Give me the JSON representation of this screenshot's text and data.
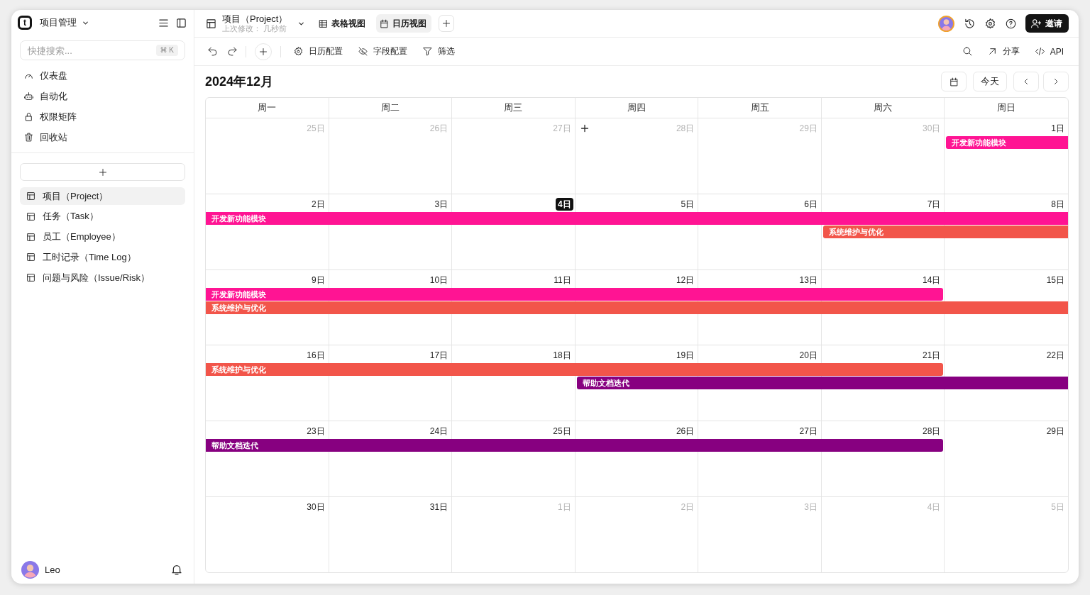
{
  "sidebar": {
    "logo": "t",
    "workspace": "项目管理",
    "search": {
      "placeholder": "快捷搜索...",
      "shortcut": "⌘ K"
    },
    "nav": [
      {
        "label": "仪表盘",
        "kind": "dashboard"
      },
      {
        "label": "自动化",
        "kind": "automation"
      },
      {
        "label": "权限矩阵",
        "kind": "permissions"
      },
      {
        "label": "回收站",
        "kind": "trash"
      }
    ],
    "tables": [
      {
        "label": "项目（Project）",
        "selected": true
      },
      {
        "label": "任务（Task）",
        "selected": false
      },
      {
        "label": "员工（Employee）",
        "selected": false
      },
      {
        "label": "工时记录（Time Log）",
        "selected": false
      },
      {
        "label": "问题与风险（Issue/Risk）",
        "selected": false
      }
    ],
    "user": {
      "name": "Leo"
    }
  },
  "header": {
    "title": "项目（Project）",
    "subtitle": "上次修改： 几秒前",
    "views": [
      {
        "label": "表格视图",
        "kind": "grid",
        "selected": false
      },
      {
        "label": "日历视图",
        "kind": "calendar",
        "selected": true
      }
    ],
    "invite": "邀请"
  },
  "toolbar": {
    "left": [
      {
        "label": "日历配置",
        "kind": "settings"
      },
      {
        "label": "字段配置",
        "kind": "hidden"
      },
      {
        "label": "筛选",
        "kind": "filter"
      }
    ],
    "right": [
      {
        "label": "分享",
        "kind": "share"
      },
      {
        "label": "API",
        "kind": "api"
      }
    ]
  },
  "calendar": {
    "title": "2024年12月",
    "today_button": "今天",
    "weekdays": [
      "周一",
      "周二",
      "周三",
      "周四",
      "周五",
      "周六",
      "周日"
    ],
    "weeks": [
      {
        "days": [
          {
            "label": "25日",
            "kind": "plain",
            "in_month": false,
            "today": false
          },
          {
            "label": "26日",
            "kind": "plain",
            "in_month": false,
            "today": false
          },
          {
            "label": "27日",
            "kind": "plain",
            "in_month": false,
            "today": false
          },
          {
            "label": "28日",
            "kind": "hover",
            "in_month": false,
            "today": false
          },
          {
            "label": "29日",
            "kind": "plain",
            "in_month": false,
            "today": false
          },
          {
            "label": "30日",
            "kind": "plain",
            "in_month": false,
            "today": false
          },
          {
            "label": "1日",
            "kind": "plain",
            "in_month": true,
            "today": false
          }
        ],
        "lanes": [
          [
            {
              "kind": "free"
            },
            {
              "kind": "free"
            },
            {
              "kind": "free"
            },
            {
              "kind": "free"
            },
            {
              "kind": "free"
            },
            {
              "kind": "free"
            },
            {
              "kind": "event",
              "title": "开发新功能模块",
              "color": "#ff1493",
              "starts": true,
              "ends": false
            }
          ]
        ]
      },
      {
        "days": [
          {
            "label": "2日",
            "kind": "plain",
            "in_month": true,
            "today": false
          },
          {
            "label": "3日",
            "kind": "plain",
            "in_month": true,
            "today": false
          },
          {
            "label": "4日",
            "kind": "plain",
            "in_month": true,
            "today": true
          },
          {
            "label": "5日",
            "kind": "plain",
            "in_month": true,
            "today": false
          },
          {
            "label": "6日",
            "kind": "plain",
            "in_month": true,
            "today": false
          },
          {
            "label": "7日",
            "kind": "plain",
            "in_month": true,
            "today": false
          },
          {
            "label": "8日",
            "kind": "plain",
            "in_month": true,
            "today": false
          }
        ],
        "lanes": [
          [
            {
              "kind": "event",
              "title": "开发新功能模块",
              "color": "#ff1493",
              "starts": false,
              "ends": false
            },
            {
              "kind": "more"
            },
            {
              "kind": "more"
            },
            {
              "kind": "more"
            },
            {
              "kind": "more"
            },
            {
              "kind": "more"
            },
            {
              "kind": "more"
            }
          ],
          [
            {
              "kind": "free"
            },
            {
              "kind": "free"
            },
            {
              "kind": "free"
            },
            {
              "kind": "free"
            },
            {
              "kind": "free"
            },
            {
              "kind": "event",
              "title": "系统维护与优化",
              "color": "#f2554a",
              "starts": true,
              "ends": false
            },
            {
              "kind": "more"
            }
          ]
        ]
      },
      {
        "days": [
          {
            "label": "9日",
            "kind": "plain",
            "in_month": true,
            "today": false
          },
          {
            "label": "10日",
            "kind": "plain",
            "in_month": true,
            "today": false
          },
          {
            "label": "11日",
            "kind": "plain",
            "in_month": true,
            "today": false
          },
          {
            "label": "12日",
            "kind": "plain",
            "in_month": true,
            "today": false
          },
          {
            "label": "13日",
            "kind": "plain",
            "in_month": true,
            "today": false
          },
          {
            "label": "14日",
            "kind": "plain",
            "in_month": true,
            "today": false
          },
          {
            "label": "15日",
            "kind": "plain",
            "in_month": true,
            "today": false
          }
        ],
        "lanes": [
          [
            {
              "kind": "event",
              "title": "开发新功能模块",
              "color": "#ff1493",
              "starts": false,
              "ends": true
            },
            {
              "kind": "more"
            },
            {
              "kind": "more"
            },
            {
              "kind": "more"
            },
            {
              "kind": "more"
            },
            {
              "kind": "more"
            }
          ],
          [
            {
              "kind": "event",
              "title": "系统维护与优化",
              "color": "#f2554a",
              "starts": false,
              "ends": false
            },
            {
              "kind": "more"
            },
            {
              "kind": "more"
            },
            {
              "kind": "more"
            },
            {
              "kind": "more"
            },
            {
              "kind": "more"
            },
            {
              "kind": "more"
            }
          ]
        ]
      },
      {
        "days": [
          {
            "label": "16日",
            "kind": "plain",
            "in_month": true,
            "today": false
          },
          {
            "label": "17日",
            "kind": "plain",
            "in_month": true,
            "today": false
          },
          {
            "label": "18日",
            "kind": "plain",
            "in_month": true,
            "today": false
          },
          {
            "label": "19日",
            "kind": "plain",
            "in_month": true,
            "today": false
          },
          {
            "label": "20日",
            "kind": "plain",
            "in_month": true,
            "today": false
          },
          {
            "label": "21日",
            "kind": "plain",
            "in_month": true,
            "today": false
          },
          {
            "label": "22日",
            "kind": "plain",
            "in_month": true,
            "today": false
          }
        ],
        "lanes": [
          [
            {
              "kind": "event",
              "title": "系统维护与优化",
              "color": "#f2554a",
              "starts": false,
              "ends": true
            },
            {
              "kind": "more"
            },
            {
              "kind": "more"
            },
            {
              "kind": "more"
            },
            {
              "kind": "more"
            },
            {
              "kind": "more"
            }
          ],
          [
            {
              "kind": "free"
            },
            {
              "kind": "free"
            },
            {
              "kind": "free"
            },
            {
              "kind": "event",
              "title": "帮助文档迭代",
              "color": "#870080",
              "starts": true,
              "ends": false
            },
            {
              "kind": "more"
            },
            {
              "kind": "more"
            },
            {
              "kind": "more"
            }
          ]
        ]
      },
      {
        "days": [
          {
            "label": "23日",
            "kind": "plain",
            "in_month": true,
            "today": false
          },
          {
            "label": "24日",
            "kind": "plain",
            "in_month": true,
            "today": false
          },
          {
            "label": "25日",
            "kind": "plain",
            "in_month": true,
            "today": false
          },
          {
            "label": "26日",
            "kind": "plain",
            "in_month": true,
            "today": false
          },
          {
            "label": "27日",
            "kind": "plain",
            "in_month": true,
            "today": false
          },
          {
            "label": "28日",
            "kind": "plain",
            "in_month": true,
            "today": false
          },
          {
            "label": "29日",
            "kind": "plain",
            "in_month": true,
            "today": false
          }
        ],
        "lanes": [
          [
            {
              "kind": "event",
              "title": "帮助文档迭代",
              "color": "#870080",
              "starts": false,
              "ends": true
            },
            {
              "kind": "more"
            },
            {
              "kind": "more"
            },
            {
              "kind": "more"
            },
            {
              "kind": "more"
            },
            {
              "kind": "more"
            }
          ]
        ]
      },
      {
        "days": [
          {
            "label": "30日",
            "kind": "plain",
            "in_month": true,
            "today": false
          },
          {
            "label": "31日",
            "kind": "plain",
            "in_month": true,
            "today": false
          },
          {
            "label": "1日",
            "kind": "plain",
            "in_month": false,
            "today": false
          },
          {
            "label": "2日",
            "kind": "plain",
            "in_month": false,
            "today": false
          },
          {
            "label": "3日",
            "kind": "plain",
            "in_month": false,
            "today": false
          },
          {
            "label": "4日",
            "kind": "plain",
            "in_month": false,
            "today": false
          },
          {
            "label": "5日",
            "kind": "plain",
            "in_month": false,
            "today": false
          }
        ]
      }
    ]
  }
}
